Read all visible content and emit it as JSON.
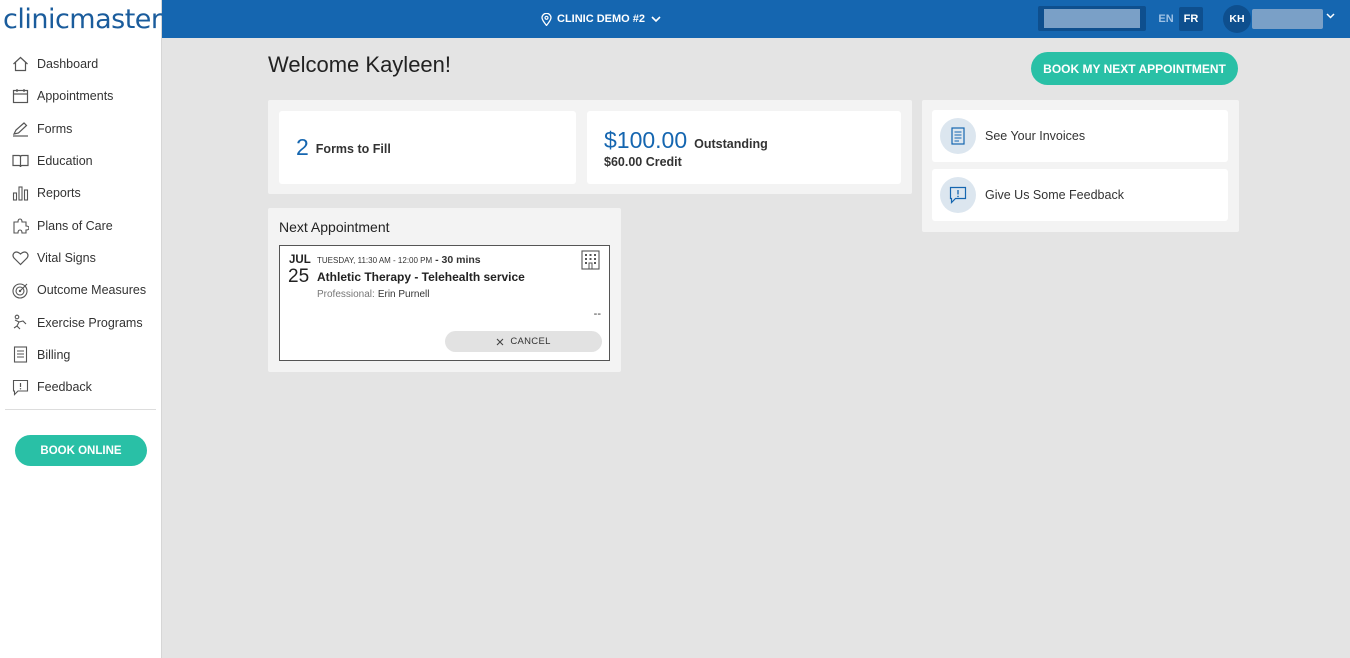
{
  "brand": {
    "name": "clinicmaster",
    "color": "#1566b0",
    "accent": "#29c0a6"
  },
  "sidebar": {
    "items": [
      {
        "label": "Dashboard",
        "icon": "home-icon"
      },
      {
        "label": "Appointments",
        "icon": "calendar-icon"
      },
      {
        "label": "Forms",
        "icon": "pen-icon"
      },
      {
        "label": "Education",
        "icon": "book-icon"
      },
      {
        "label": "Reports",
        "icon": "bar-chart-icon"
      },
      {
        "label": "Plans of Care",
        "icon": "puzzle-icon"
      },
      {
        "label": "Vital Signs",
        "icon": "heart-icon"
      },
      {
        "label": "Outcome Measures",
        "icon": "target-icon"
      },
      {
        "label": "Exercise Programs",
        "icon": "exercise-icon"
      },
      {
        "label": "Billing",
        "icon": "receipt-icon"
      },
      {
        "label": "Feedback",
        "icon": "feedback-icon"
      }
    ],
    "book_online": "BOOK ONLINE"
  },
  "topbar": {
    "clinic": "CLINIC DEMO #2",
    "lang_en": "EN",
    "lang_fr": "FR",
    "user_initials": "KH"
  },
  "main": {
    "welcome": "Welcome Kayleen!",
    "book_next": "BOOK MY NEXT APPOINTMENT",
    "forms_count": "2",
    "forms_label": "Forms to Fill",
    "outstanding_amount": "$100.00",
    "outstanding_label": "Outstanding",
    "credit": "$60.00 Credit",
    "invoices_label": "See Your Invoices",
    "feedback_label": "Give Us Some Feedback"
  },
  "appointment": {
    "section_title": "Next Appointment",
    "month": "JUL",
    "day": "25",
    "time": "TUESDAY, 11:30 AM - 12:00 PM",
    "duration": "- 30 mins",
    "service": "Athletic Therapy - Telehealth service",
    "professional_label": "Professional:",
    "professional": "Erin Purnell",
    "location": "--",
    "cancel": "CANCEL"
  }
}
